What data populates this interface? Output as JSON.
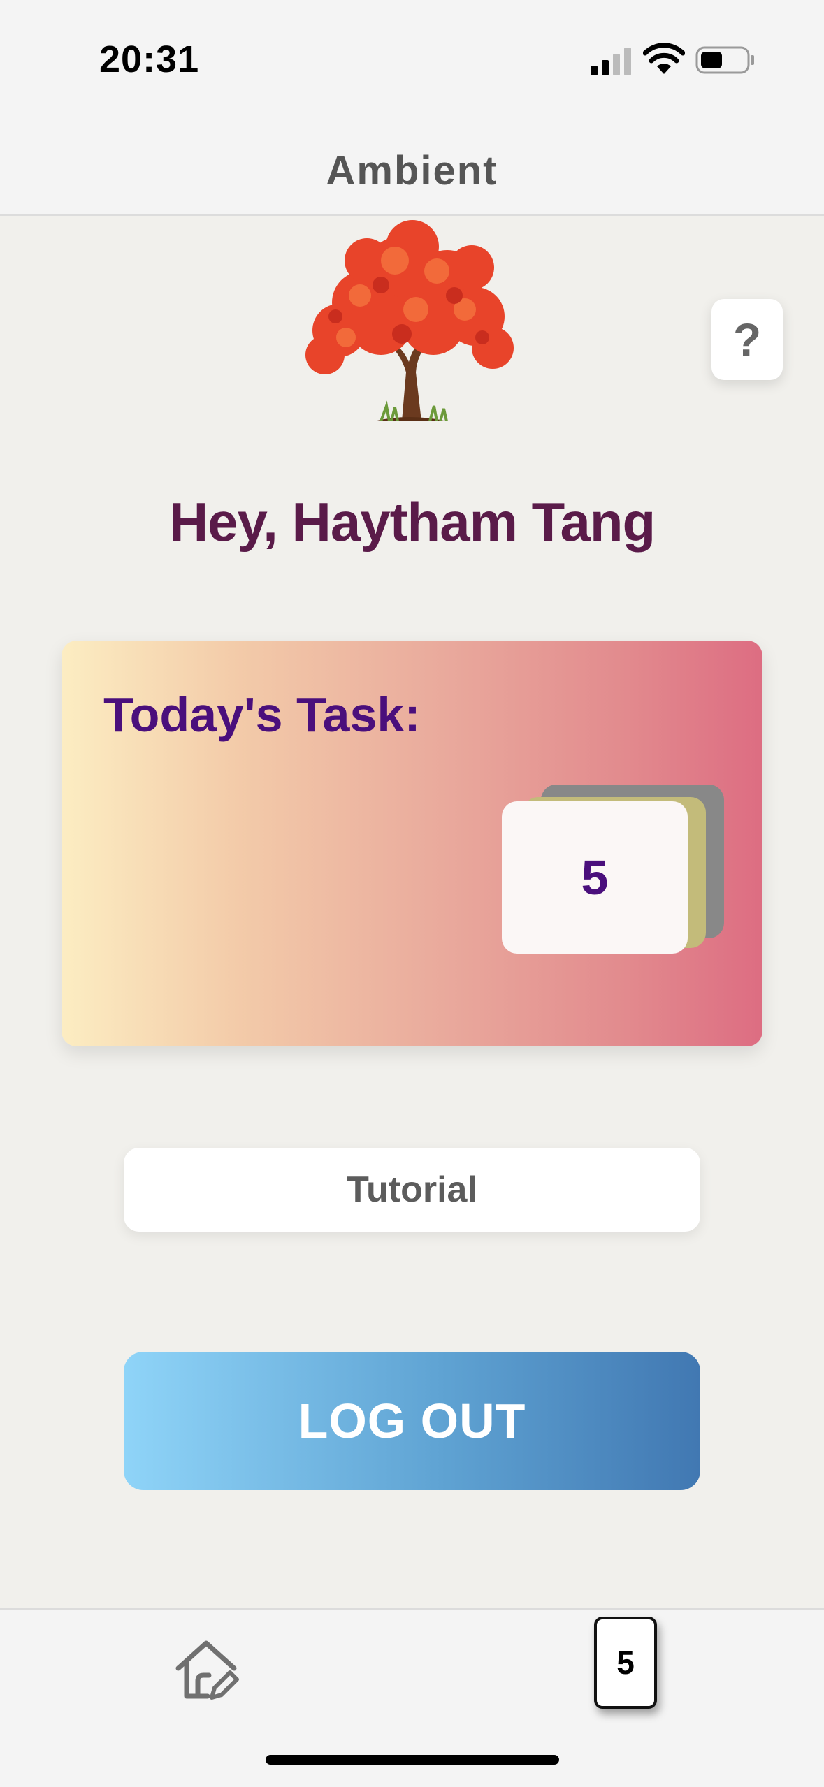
{
  "status_bar": {
    "time": "20:31",
    "icons": [
      "cellular-signal-icon",
      "wifi-icon",
      "battery-icon"
    ]
  },
  "header": {
    "title": "Ambient"
  },
  "hero": {
    "image": "red-tree-icon"
  },
  "help": {
    "label": "?"
  },
  "greeting": "Hey, Haytham Tang",
  "task_card": {
    "title": "Today's Task:",
    "count": "5"
  },
  "buttons": {
    "tutorial": "Tutorial",
    "logout": "LOG OUT"
  },
  "tab_bar": {
    "home_icon": "home-edit-icon",
    "count": "5"
  },
  "colors": {
    "greeting": "#5a1b49",
    "task_text": "#4a0f7c",
    "card_gradient_start": "#fcedc2",
    "card_gradient_end": "#dd6d82",
    "logout_gradient_start": "#8fd4f8",
    "logout_gradient_end": "#4178b2"
  }
}
